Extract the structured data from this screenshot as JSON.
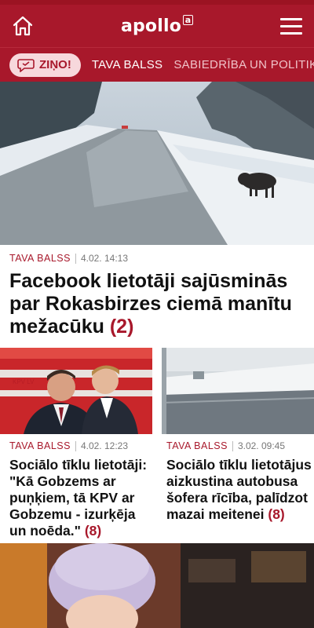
{
  "header": {
    "logo_text": "apollo",
    "logo_badge": "a",
    "home_icon": "home-icon",
    "menu_icon": "hamburger-menu-icon"
  },
  "tabs": {
    "zino_label": "ZIŅO!",
    "zino_icon": "chat-bubble-icon",
    "items": [
      "TAVA BALSS",
      "SABIEDRĪBA UN POLITIKA"
    ]
  },
  "colors": {
    "brand": "#a8182b",
    "pill_bg": "#f7d8dc"
  },
  "articles": [
    {
      "category": "TAVA BALSS",
      "time": "4.02. 14:13",
      "title": "Facebook lietotāji sajūsminās par Rokasbirzes ciemā manītu mežacūku",
      "comments": "(2)"
    },
    {
      "category": "TAVA BALSS",
      "time": "4.02. 12:23",
      "title": "Sociālo tīklu lietotāji: \"Kā Gobzems ar puņķiem, tā KPV ar Gobzemu - izurķēja un noēda.\"",
      "comments": "(8)"
    },
    {
      "category": "TAVA BALSS",
      "time": "3.02. 09:45",
      "title": "Sociālo tīklu lietotājus aizkustina autobusa šofera rīcība, palīdzot mazai meitenei",
      "comments": "(8)"
    }
  ],
  "thumb_labels": {
    "kpv_sign": "KPV LV"
  }
}
